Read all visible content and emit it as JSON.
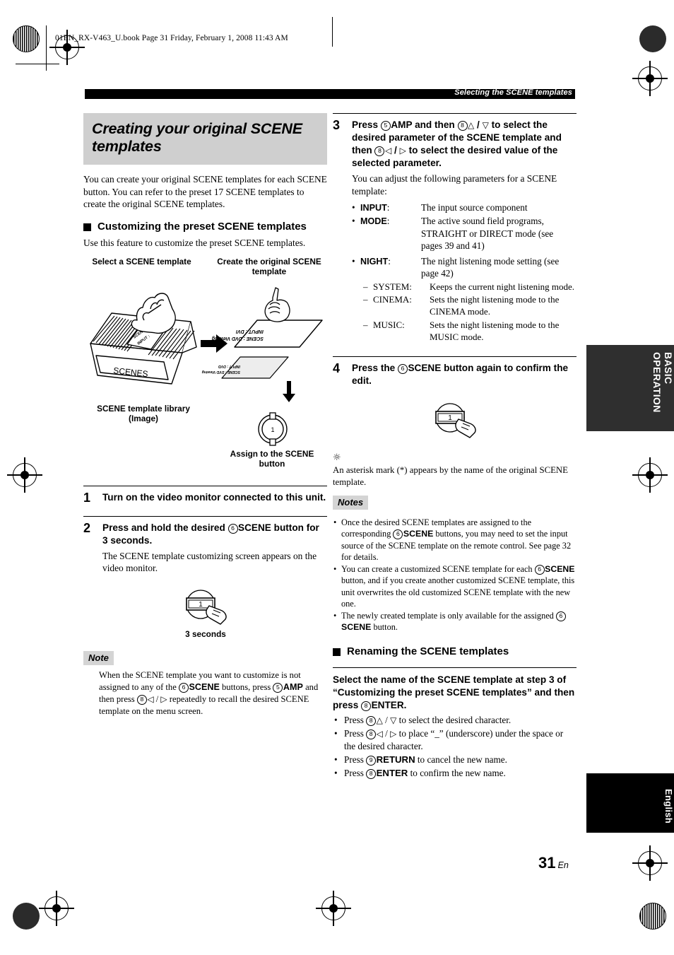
{
  "page": {
    "file_header": "01EN_RX-V463_U.book  Page 31  Friday, February 1, 2008  11:43 AM",
    "running_head": "Selecting the SCENE templates",
    "page_number": "31",
    "page_number_suffix": "En"
  },
  "side_tabs": {
    "basic": "BASIC OPERATION",
    "language": "English"
  },
  "left_column": {
    "title": "Creating your original SCENE templates",
    "intro": "You can create your original SCENE templates for each SCENE button. You can refer to the preset 17 SCENE templates to create the original SCENE templates.",
    "section_heading": "Customizing the preset SCENE templates",
    "section_intro": "Use this feature to customize the preset SCENE templates.",
    "figure": {
      "caption_left": "Select a SCENE template",
      "caption_right": "Create the original SCENE template",
      "library_label_line1": "SCENE template library",
      "library_label_line2": "(Image)",
      "box_label": "SCENES",
      "card_line1": "SCENE :",
      "card_line2": "INPUT :",
      "sheet_line1": "SCENE : DVD Viewing",
      "sheet_line2": "INPUT : DVI",
      "sheet2_line1": "SCENE : DVD Viewing",
      "sheet2_line2": "INPUT : DVD",
      "assign_caption_line1": "Assign to the SCENE",
      "assign_caption_line2": "button",
      "button_number": "1"
    },
    "steps": [
      {
        "num": "1",
        "lead_html": "Turn on the video monitor connected to this unit.",
        "lead_text": "Turn on the video monitor connected to this unit."
      },
      {
        "num": "2",
        "lead_text": "Press and hold the desired ⓬SCENE button for 3 seconds.",
        "sub_text": "The SCENE template customizing screen appears on the video monitor."
      }
    ],
    "hold_figure": {
      "button_number": "1",
      "caption": "3 seconds"
    },
    "note": {
      "tag": "Note",
      "text": "When the SCENE template you want to customize is not assigned to any of the ⓬SCENE buttons, press ⓈAMP and then press Ⓛ◁ / ▷ repeatedly to recall the desired SCENE template on the menu screen."
    }
  },
  "right_column": {
    "step3": {
      "num": "3",
      "lead_text": "Press ⓈAMP and then Ⓛ△ / ▽ to select the desired parameter of the SCENE template and then Ⓛ◁ / ▷ to select the desired value of the selected parameter.",
      "sub_text": "You can adjust the following parameters for a SCENE template:"
    },
    "parameters": [
      {
        "key": "INPUT",
        "value": "The input source component"
      },
      {
        "key": "MODE",
        "value": "The active sound field programs, STRAIGHT or DIRECT mode (see pages 39 and 41)"
      },
      {
        "key": "NIGHT",
        "value": "The night listening mode setting (see page 42)"
      }
    ],
    "night_options": [
      {
        "key": "SYSTEM:",
        "value": "Keeps the current night listening mode."
      },
      {
        "key": "CINEMA:",
        "value": "Sets the night listening mode to the CINEMA mode."
      },
      {
        "key": "MUSIC:",
        "value": "Sets the night listening mode to the MUSIC mode."
      }
    ],
    "step4": {
      "num": "4",
      "lead_text": "Press the ⓬SCENE button again to confirm the edit.",
      "button_number": "1"
    },
    "tip": {
      "glyph": "tip-icon",
      "text": "An asterisk mark (*) appears by the name of the original SCENE template."
    },
    "notes": {
      "tag": "Notes",
      "items": [
        "Once the desired SCENE templates are assigned to the corresponding ⓬SCENE buttons, you may need to set the input source of the SCENE template on the remote control. See page 32 for details.",
        "You can create a customized SCENE template for each ⓬SCENE button, and if you create another customized SCENE template, this unit overwrites the old customized SCENE template with the new one.",
        "The newly created template is only available for the assigned ⓬SCENE button."
      ]
    },
    "rename_heading": "Renaming the SCENE templates",
    "rename_lead": "Select the name of the SCENE template at step 3 of “Customizing the preset SCENE templates” and then press ⓁENTER.",
    "rename_items": [
      "Press Ⓛ△ / ▽ to select the desired character.",
      "Press Ⓛ◁ / ▷ to place “_” (underscore) under the space or the desired character.",
      "Press ⓉRETURN to cancel the new name.",
      "Press ⓁENTER to confirm the new name."
    ]
  }
}
